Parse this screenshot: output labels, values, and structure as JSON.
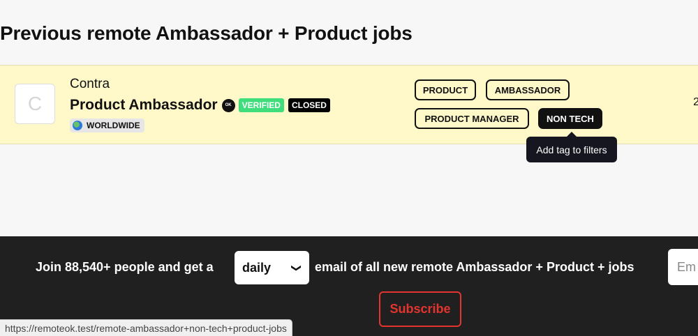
{
  "section_title": "Previous remote Ambassador + Product jobs",
  "job": {
    "logo_letter": "C",
    "company": "Contra",
    "title": "Product Ambassador",
    "ok_label": "OK",
    "verified_badge": "VERIFIED",
    "closed_badge": "CLOSED",
    "location": "WORLDWIDE",
    "tags": [
      "PRODUCT",
      "AMBASSADOR",
      "PRODUCT MANAGER",
      "NON TECH"
    ],
    "right_edge_text": "2"
  },
  "tooltip": "Add tag to filters",
  "footer": {
    "text_before": "Join 88,540+ people and get a",
    "frequency_selected": "daily",
    "text_after": "email of all new remote Ambassador + Product + jobs",
    "email_placeholder": "Em",
    "subscribe_label": "Subscribe"
  },
  "status_bar_url": "https://remoteok.test/remote-ambassador+non-tech+product-jobs",
  "colors": {
    "row_highlight": "#fff9c9",
    "verified": "#3fdd7b",
    "subscribe_red": "#e3342f",
    "footer_bg": "#202020"
  }
}
